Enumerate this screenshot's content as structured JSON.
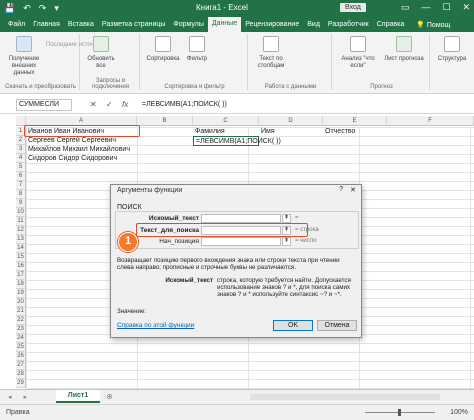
{
  "window": {
    "title": "Книга1 - Excel",
    "signin": "Вход",
    "quick_access": [
      "💾",
      "↶",
      "↷",
      "▾"
    ],
    "win_buttons": [
      "▭",
      "—",
      "☐",
      "✕"
    ]
  },
  "tabs": [
    "Файл",
    "Главная",
    "Вставка",
    "Разметка страницы",
    "Формулы",
    "Данные",
    "Рецензирование",
    "Вид",
    "Разработчик",
    "Справка"
  ],
  "active_tab": "Данные",
  "tell_me": "Помощ",
  "ribbon": {
    "get_data": "Получение внешних данных",
    "recent_sources": "Последние источники",
    "update_all": "Обновить все",
    "sort": "Сортировка",
    "filter": "Фильтр",
    "text_columns": "Текст по столбцам",
    "what_if": "Анализ \"что если\"",
    "forecast_sheet": "Лист прогноза",
    "structure": "Структура",
    "group_get": "Скачать и преобразовать",
    "group_queries": "Запросы и подключения",
    "group_sort": "Сортировка и фильтр",
    "group_data_tools": "Работа с данными",
    "group_forecast": "Прогноз"
  },
  "formula_bar": {
    "name_box": "СУММЕСЛИ",
    "cancel": "✕",
    "enter": "✓",
    "fx": "fx",
    "formula": "=ЛЕВСИМВ(A1;ПОИСК( ))"
  },
  "grid": {
    "columns": [
      "A",
      "B",
      "C",
      "D",
      "E",
      "F"
    ],
    "rows": [
      "1",
      "2",
      "3",
      "4",
      "5",
      "6",
      "7",
      "8",
      "9",
      "10",
      "11",
      "12",
      "13",
      "14",
      "15",
      "16",
      "17",
      "18",
      "19",
      "20",
      "21",
      "22",
      "23",
      "24",
      "25",
      "26",
      "27",
      "28",
      "29"
    ],
    "cells": {
      "a1": "Иванов Иван Иванович",
      "a2": "Сергеев Сергей Сергеевич",
      "a3": "Михайлов Михаил Михайлович",
      "a4": "Сидоров Сидор Сидорович",
      "c1": "Фамилия",
      "d1": "Имя",
      "e1": "Отчество",
      "c2": "=ЛЕВСИМВ(A1;ПОИСК( ))"
    }
  },
  "dialog": {
    "title": "Аргументы функции",
    "help": "?",
    "close": "✕",
    "function_name": "ПОИСК",
    "args": [
      {
        "label": "Искомый_текст",
        "value": "",
        "result": "="
      },
      {
        "label": "Текст_для_поиска",
        "value": "",
        "result": "= строка"
      },
      {
        "label": "Нач_позиция",
        "value": "",
        "result": "= число"
      }
    ],
    "description": "Возвращает позицию первого вхождения знака или строки текста при чтении слева направо; прописные и строчные буквы не различаются.",
    "arg_name": "Искомый_текст",
    "arg_desc": "строка, которую требуется найти. Допускается использование знаков ? и *, для поиска самих знаков ? и * используйте синтаксис ~? и ~*.",
    "value_label": "Значение:",
    "help_link": "Справка по этой функции",
    "ok": "OK",
    "cancel": "Отмена"
  },
  "callout": "1",
  "sheet": {
    "nav": "◂ ▸",
    "name": "Лист1",
    "add": "⊕"
  },
  "status": {
    "mode": "Правка",
    "zoom": "100%"
  },
  "colors": {
    "excel_green": "#217346",
    "highlight_red": "#e04b2b",
    "callout_orange": "#f27a2a"
  }
}
